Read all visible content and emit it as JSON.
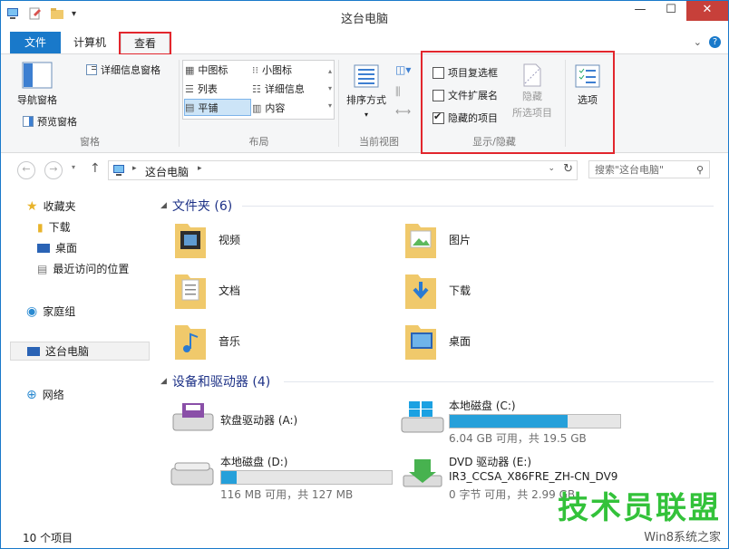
{
  "window": {
    "title": "这台电脑"
  },
  "tabs": {
    "file": "文件",
    "computer": "计算机",
    "view": "查看"
  },
  "ribbon": {
    "pane": {
      "nav_pane": "导航窗格",
      "preview_pane": "预览窗格",
      "details_pane": "详细信息窗格",
      "group": "窗格"
    },
    "layout": {
      "items": [
        "中图标",
        "小图标",
        "列表",
        "详细信息",
        "平铺",
        "内容"
      ],
      "selected": "平铺",
      "group": "布局"
    },
    "current_view": {
      "sort": "排序方式",
      "group": "当前视图"
    },
    "show_hide": {
      "checkboxes": [
        {
          "label": "项目复选框",
          "checked": false
        },
        {
          "label": "文件扩展名",
          "checked": false
        },
        {
          "label": "隐藏的项目",
          "checked": true
        }
      ],
      "hide_selected_line1": "隐藏",
      "hide_selected_line2": "所选项目",
      "group": "显示/隐藏"
    },
    "options": {
      "label": "选项"
    }
  },
  "address": {
    "location": "这台电脑",
    "search_placeholder": "搜索\"这台电脑\""
  },
  "nav": {
    "items": [
      {
        "label": "收藏夹",
        "icon": "star-icon"
      },
      {
        "label": "下载",
        "icon": "download-folder-icon"
      },
      {
        "label": "桌面",
        "icon": "desktop-icon"
      },
      {
        "label": "最近访问的位置",
        "icon": "recent-icon"
      },
      {
        "label": "家庭组",
        "icon": "homegroup-icon"
      },
      {
        "label": "这台电脑",
        "icon": "computer-icon"
      },
      {
        "label": "网络",
        "icon": "network-icon"
      }
    ]
  },
  "folders_section": {
    "title": "文件夹 (6)",
    "items": [
      "视频",
      "图片",
      "文档",
      "下载",
      "音乐",
      "桌面"
    ]
  },
  "drives_section": {
    "title": "设备和驱动器 (4)",
    "items": [
      {
        "name": "软盘驱动器 (A:)",
        "info": "",
        "fill": 0
      },
      {
        "name": "本地磁盘 (C:)",
        "info": "6.04 GB 可用，共 19.5 GB",
        "fill": 0.69
      },
      {
        "name": "本地磁盘 (D:)",
        "info": "116 MB 可用，共 127 MB",
        "fill": 0.09
      },
      {
        "name": "DVD 驱动器 (E:)",
        "info2": "IR3_CCSA_X86FRE_ZH-CN_DV9",
        "info": "0 字节 可用，共 2.99 GB",
        "fill": 0
      }
    ]
  },
  "status": {
    "count": "10 个项目"
  },
  "watermark": {
    "line1": "技术员联盟",
    "line2": "Win8系统之家"
  },
  "colors": {
    "accent": "#1979ca",
    "highlight_box": "#e2262d",
    "drive_fill": "#26a0da"
  }
}
